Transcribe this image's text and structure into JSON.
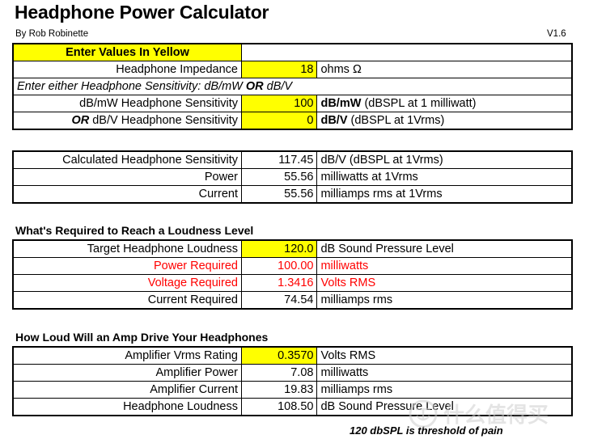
{
  "header": {
    "title": "Headphone Power Calculator",
    "byline": "By Rob Robinette",
    "version": "V1.6"
  },
  "colors": {
    "input_highlight": "#FFFF00",
    "alert_text": "#FF0000",
    "text": "#000000",
    "background": "#FFFFFF"
  },
  "input_section": {
    "banner": "Enter Values In Yellow",
    "note": "Enter either Headphone Sensitivity: dB/mW  OR  dB/V",
    "note_parts": {
      "before": "Enter either Headphone Sensitivity: dB/mW",
      "emphasis": "OR",
      "after": "dB/V"
    },
    "rows": [
      {
        "label": "Headphone Impedance",
        "value": "18",
        "unit": "ohms Ω",
        "unit_bold": "",
        "unit_rest": "ohms Ω"
      },
      {
        "label": "dB/mW Headphone Sensitivity",
        "value": "100",
        "unit": "dB/mW  (dBSPL at 1 milliwatt)",
        "unit_bold": "dB/mW",
        "unit_rest": "(dBSPL at 1 milliwatt)"
      },
      {
        "label": "OR dB/V Headphone Sensitivity",
        "label_bold": "OR",
        "label_rest": "dB/V Headphone Sensitivity",
        "value": "0",
        "unit": "dB/V  (dBSPL at 1Vrms)",
        "unit_bold": "dB/V",
        "unit_rest": "(dBSPL at 1Vrms)"
      }
    ]
  },
  "calculated_section": {
    "rows": [
      {
        "label": "Calculated Headphone Sensitivity",
        "value": "117.45",
        "unit": "dB/V  (dBSPL at 1Vrms)"
      },
      {
        "label": "Power",
        "value": "55.56",
        "unit": "milliwatts at 1Vrms"
      },
      {
        "label": "Current",
        "value": "55.56",
        "unit": "milliamps rms at 1Vrms"
      }
    ]
  },
  "loudness_section": {
    "heading": "What's Required to Reach a Loudness Level",
    "rows": [
      {
        "label": "Target Headphone Loudness",
        "value": "120.0",
        "unit": "dB Sound Pressure Level"
      },
      {
        "label": "Power Required",
        "value": "100.00",
        "unit": "milliwatts"
      },
      {
        "label": "Voltage Required",
        "value": "1.3416",
        "unit": "Volts RMS"
      },
      {
        "label": "Current Required",
        "value": "74.54",
        "unit": "milliamps rms"
      }
    ]
  },
  "amp_section": {
    "heading": "How Loud Will an Amp Drive Your Headphones",
    "rows": [
      {
        "label": "Amplifier Vrms Rating",
        "value": "0.3570",
        "unit": "Volts RMS"
      },
      {
        "label": "Amplifier Power",
        "value": "7.08",
        "unit": "milliwatts"
      },
      {
        "label": "Amplifier Current",
        "value": "19.83",
        "unit": "milliamps rms"
      },
      {
        "label": "Headphone Loudness",
        "value": "108.50",
        "unit": "dB Sound Pressure Level"
      }
    ],
    "footnote": "120 dbSPL is threshold of pain"
  },
  "watermark": {
    "text": "什么值得买",
    "icon": "smzdm-logo-icon"
  }
}
